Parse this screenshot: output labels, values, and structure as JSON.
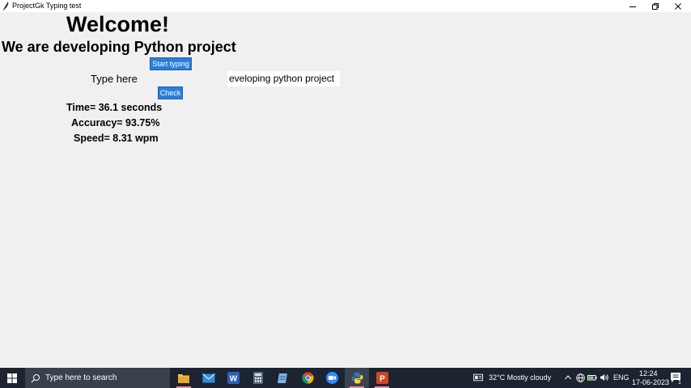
{
  "window": {
    "title": "ProjectGk Typing test"
  },
  "content": {
    "heading": "Welcome!",
    "subtitle": "We are developing Python project",
    "start_button": "Start typing",
    "type_label": "Type here",
    "input_value": "eveloping python project",
    "check_button": "Check",
    "result_time": "Time= 36.1 seconds",
    "result_accuracy": "Accuracy= 93.75%",
    "result_speed": "Speed= 8.31 wpm"
  },
  "taskbar": {
    "search_placeholder": "Type here to search",
    "apps": [
      "file-explorer",
      "mail",
      "word",
      "calculator",
      "notepad",
      "chrome",
      "zoom",
      "python",
      "powerpoint"
    ],
    "weather": "32°C  Mostly cloudy",
    "language": "ENG",
    "time": "12:24",
    "date": "17-06-2023",
    "notification_count": "1"
  },
  "colors": {
    "button_blue": "#2b7fd9",
    "taskbar_bg": "#1c2431",
    "window_bg": "#f0f0f0"
  }
}
